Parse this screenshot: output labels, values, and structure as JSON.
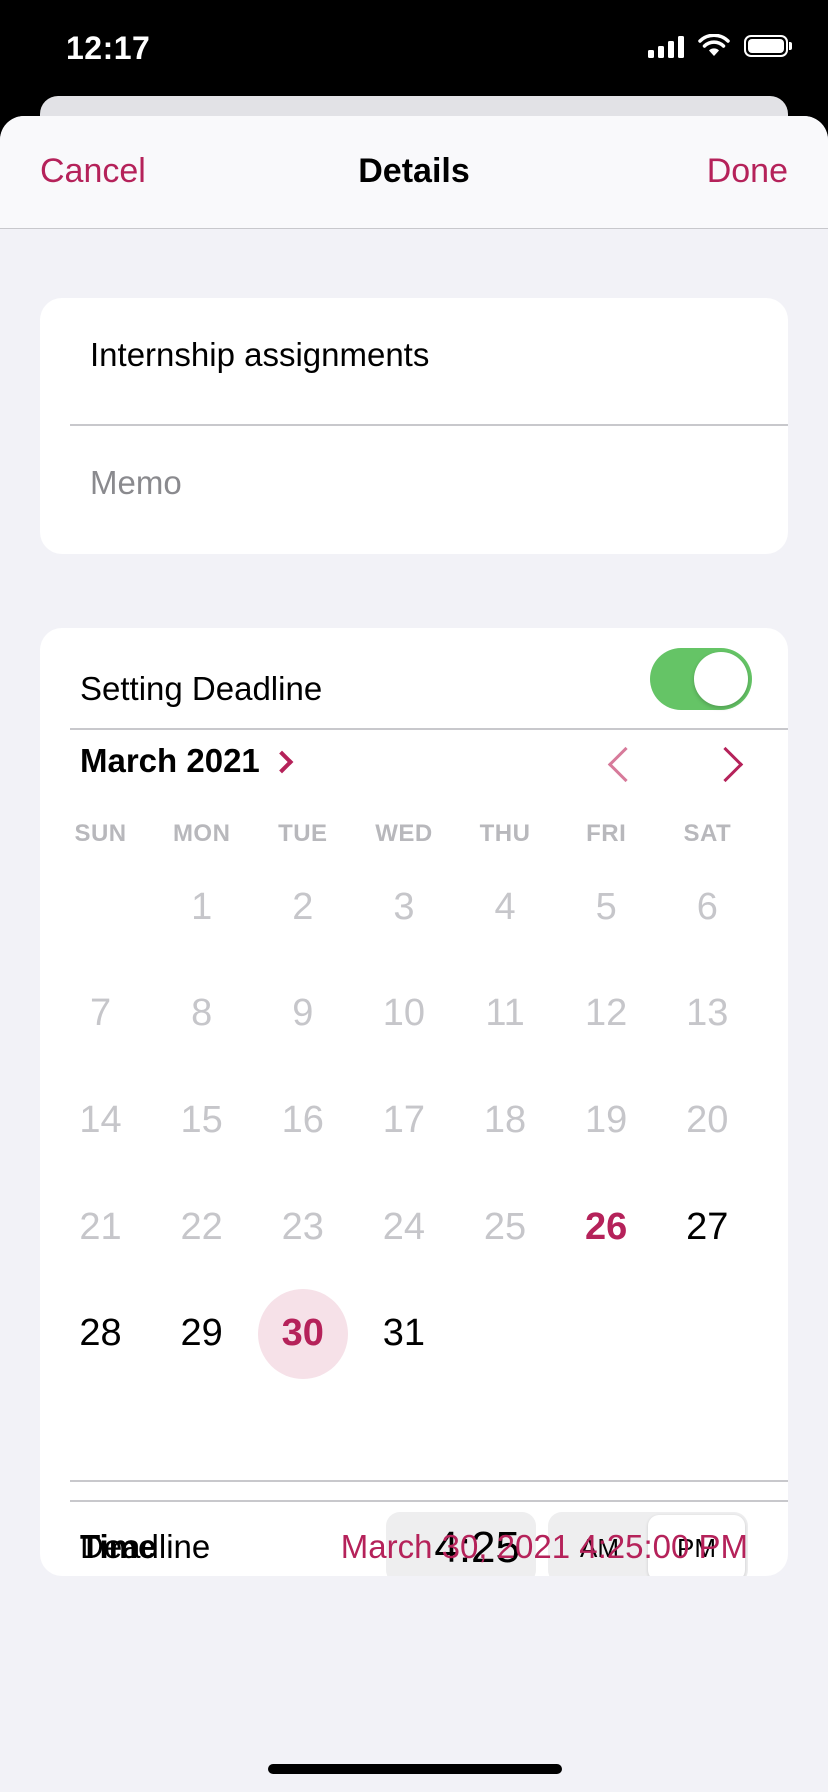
{
  "status_bar": {
    "time": "12:17"
  },
  "nav": {
    "cancel_label": "Cancel",
    "title": "Details",
    "done_label": "Done"
  },
  "task": {
    "title": "Internship assignments",
    "memo_placeholder": "Memo"
  },
  "deadline": {
    "toggle_label": "Setting Deadline",
    "toggle_on": true,
    "month_label": "March 2021",
    "weekdays": [
      "SUN",
      "MON",
      "TUE",
      "WED",
      "THU",
      "FRI",
      "SAT"
    ],
    "first_weekday_index": 1,
    "days_in_month": 31,
    "today": 26,
    "selected": 30,
    "time_label": "Time",
    "time_value": "4:25",
    "am_label": "AM",
    "pm_label": "PM",
    "period_selected": "PM",
    "deadline_label": "Deadline",
    "deadline_value": "March 30, 2021 4:25:00 PM"
  },
  "colors": {
    "accent": "#b5225a",
    "toggle_on": "#65c466",
    "selected_bg": "#f6e1e8",
    "background": "#f2f2f7"
  }
}
